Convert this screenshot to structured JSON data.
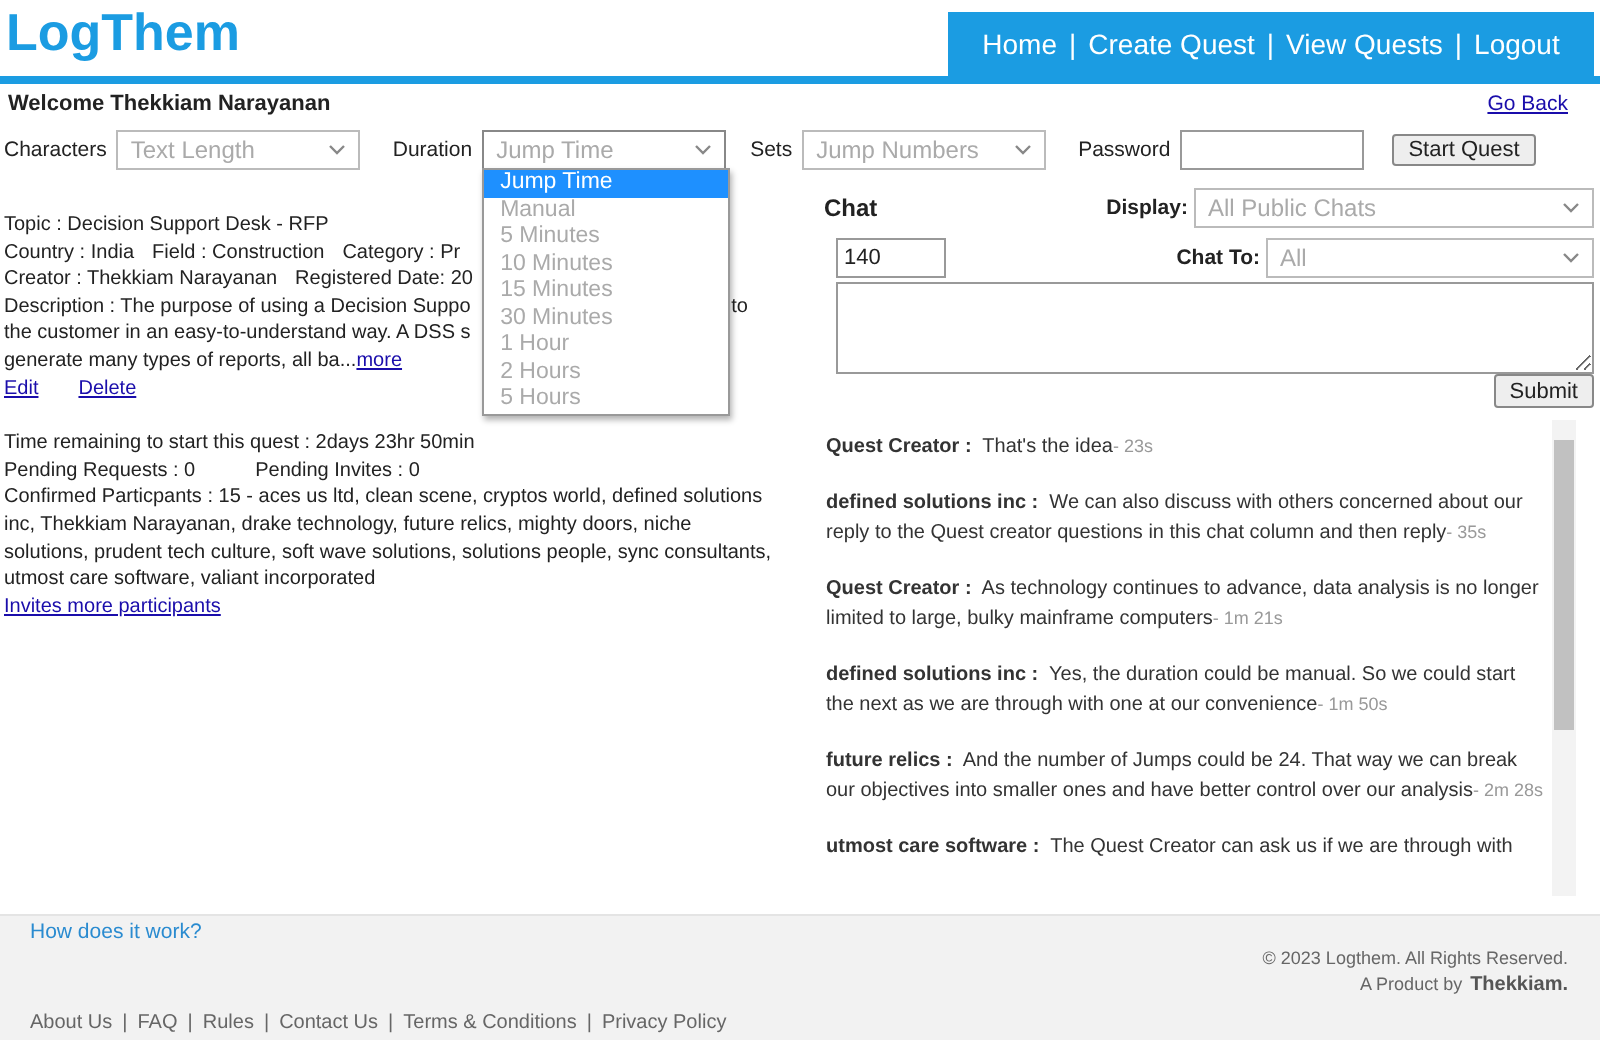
{
  "logo": "LogThem",
  "nav": [
    {
      "label": "Home"
    },
    {
      "label": "Create Quest"
    },
    {
      "label": "View Quests"
    },
    {
      "label": "Logout"
    }
  ],
  "nav_separator": "|",
  "welcome": "Welcome Thekkiam Narayanan",
  "go_back": "Go Back",
  "filters": {
    "characters": {
      "label": "Characters",
      "placeholder": "Text Length"
    },
    "duration": {
      "label": "Duration",
      "placeholder": "Jump Time",
      "expanded": true,
      "options": [
        {
          "label": "Jump Time",
          "selected": true
        },
        {
          "label": "Manual",
          "selected": false
        },
        {
          "label": "5 Minutes",
          "selected": false
        },
        {
          "label": "10 Minutes",
          "selected": false
        },
        {
          "label": "15 Minutes",
          "selected": false
        },
        {
          "label": "30 Minutes",
          "selected": false
        },
        {
          "label": "1 Hour",
          "selected": false
        },
        {
          "label": "2 Hours",
          "selected": false
        },
        {
          "label": "5 Hours",
          "selected": false
        }
      ]
    },
    "sets": {
      "label": "Sets",
      "placeholder": "Jump Numbers"
    },
    "password": {
      "label": "Password"
    },
    "start_button": "Start Quest"
  },
  "quest": {
    "topic": "Topic : Decision Support Desk - RFP",
    "details_line": [
      "Country : India",
      "Field : Construction",
      "Category : Pr"
    ],
    "creator_line": [
      "Creator : Thekkiam Narayanan",
      "Registered Date: 20"
    ],
    "description_lines": [
      {
        "left": "Description : The purpose of using a Decision Suppo",
        "right": "to"
      },
      {
        "left": "the customer in an easy-to-understand way. A DSS s"
      },
      {
        "left": "generate many types of reports, all ba..."
      }
    ],
    "more": "more",
    "edit": "Edit",
    "delete": "Delete",
    "time_remaining": "Time remaining to start this quest : 2days 23hr 50min",
    "pending_requests": "Pending Requests : 0",
    "pending_invites": "Pending Invites : 0",
    "participants": "Confirmed Particpants : 15 - aces us ltd, clean scene, cryptos world, defined solutions inc, Thekkiam Narayanan, drake technology, future relics, mighty doors, niche solutions, prudent tech culture, soft wave solutions, solutions people, sync consultants, utmost care software, valiant incorporated",
    "invite_link": "Invites more participants"
  },
  "chat": {
    "title": "Chat",
    "display_label": "Display:",
    "display_value": "All Public Chats",
    "char_count": "140",
    "chat_to_label": "Chat To:",
    "chat_to_value": "All",
    "submit": "Submit",
    "messages": [
      {
        "author": "Quest Creator :",
        "text": "That's the idea",
        "time": "- 23s"
      },
      {
        "author": "defined solutions inc :",
        "text": "We can also discuss with others concerned about our reply to the Quest creator questions in this chat column and then reply",
        "time": "- 35s"
      },
      {
        "author": "Quest Creator :",
        "text": "As technology continues to advance, data analysis is no longer limited to large, bulky mainframe computers",
        "time": "- 1m 21s"
      },
      {
        "author": "defined solutions inc :",
        "text": "Yes, the duration could be manual. So we could start the next as we are through with one at our convenience",
        "time": "- 1m 50s"
      },
      {
        "author": "future relics :",
        "text": "And the number of Jumps could be 24. That way we can break our objectives into smaller ones and have better control over our analysis",
        "time": "- 2m 28s"
      },
      {
        "author": "utmost care software :",
        "text": "The Quest Creator can ask us if we are through with"
      }
    ]
  },
  "footer": {
    "how": "How does it work?",
    "copyright": "© 2023 Logthem. All Rights Reserved.",
    "product": "A Product by",
    "company": "Thekkiam.",
    "links": [
      "About Us",
      "FAQ",
      "Rules",
      "Contact Us",
      "Terms & Conditions",
      "Privacy Policy"
    ],
    "separator": "|"
  }
}
